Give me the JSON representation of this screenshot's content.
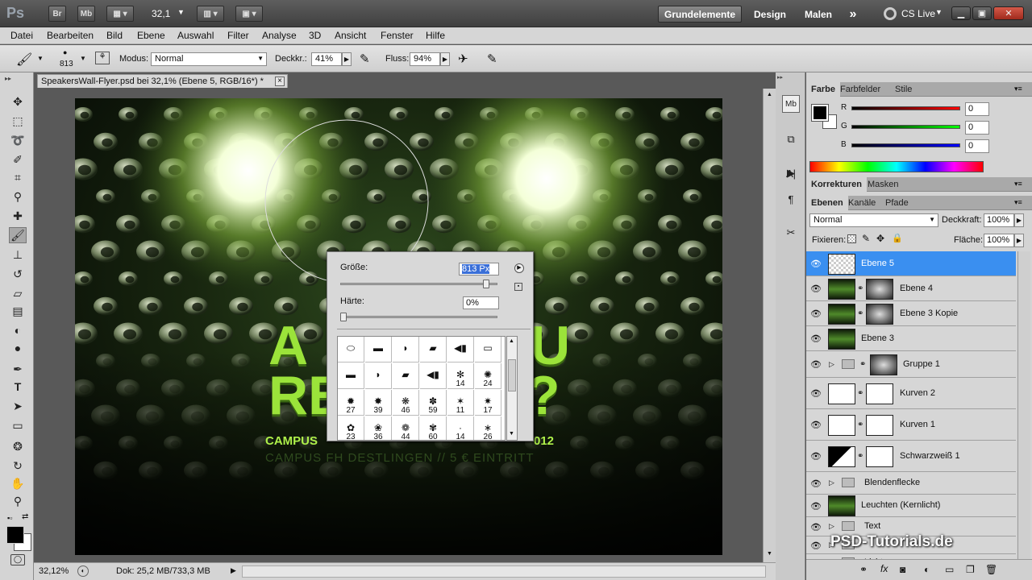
{
  "appbar": {
    "logo": "Ps",
    "btn_br": "Br",
    "btn_mb": "Mb",
    "zoom": "32,1",
    "workspaces": [
      "Grundelemente",
      "Design",
      "Malen"
    ],
    "more": "»",
    "cslive": "CS Live"
  },
  "menu": [
    "Datei",
    "Bearbeiten",
    "Bild",
    "Ebene",
    "Auswahl",
    "Filter",
    "Analyse",
    "3D",
    "Ansicht",
    "Fenster",
    "Hilfe"
  ],
  "options": {
    "brush_size": "813",
    "mode_label": "Modus:",
    "mode_value": "Normal",
    "opacity_label": "Deckkr.:",
    "opacity_value": "41%",
    "flow_label": "Fluss:",
    "flow_value": "94%"
  },
  "document": {
    "tab_title": "SpeakersWall-Flyer.psd bei 32,1% (Ebene 5, RGB/16*) *",
    "close": "×"
  },
  "canvas_text": {
    "line1_left": "A",
    "line1_right": "U",
    "line2_left": "RE",
    "line2_right": "?",
    "campus_left": "CAMPUS",
    "campus_right": "012",
    "subline": "CAMPUS FH DESTLINGEN  //  5 € EINTRITT"
  },
  "brush_popup": {
    "size_label": "Größe:",
    "size_value": "813 Px",
    "hardness_label": "Härte:",
    "hardness_value": "0%",
    "size_fraction": 0.93,
    "hardness_fraction": 0.0,
    "brush_numbers": [
      "",
      "",
      "",
      "",
      "",
      "",
      "",
      "",
      "",
      "",
      "14",
      "24",
      "27",
      "39",
      "46",
      "59",
      "11",
      "17",
      "23",
      "36",
      "44",
      "60",
      "14",
      "26"
    ]
  },
  "status": {
    "zoom": "32,12%",
    "doc": "Dok: 25,2 MB/733,3 MB"
  },
  "color_panel": {
    "tabs": [
      "Farbe",
      "Farbfelder",
      "Stile"
    ],
    "r_label": "R",
    "g_label": "G",
    "b_label": "B",
    "r": "0",
    "g": "0",
    "b": "0"
  },
  "adjust_panel": {
    "tabs": [
      "Korrekturen",
      "Masken"
    ]
  },
  "layers_panel": {
    "tabs": [
      "Ebenen",
      "Kanäle",
      "Pfade"
    ],
    "blend": "Normal",
    "opacity_label": "Deckkraft:",
    "opacity": "100%",
    "lock_label": "Fixieren:",
    "fill_label": "Fläche:",
    "fill": "100%",
    "layers": [
      "Ebene 5",
      "Ebene 4",
      "Ebene 3 Kopie",
      "Ebene 3",
      "Gruppe 1",
      "Kurven 2",
      "Kurven 1",
      "Schwarzweiß 1",
      "Blendenflecke",
      "Leuchten (Kernlicht)",
      "Text",
      "",
      "Licht"
    ]
  },
  "watermark": "PSD-Tutorials.de",
  "colors": {
    "selected_layer": "#3a8ff0",
    "accent_green": "#9be33a"
  }
}
